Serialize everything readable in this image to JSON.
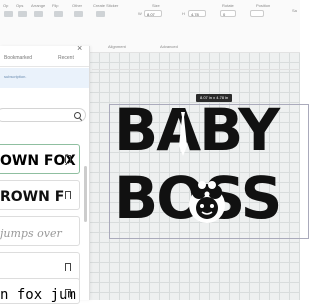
{
  "toolbar": {
    "items": [
      "Op",
      "Ops",
      "Arrange",
      "Flip",
      "Other"
    ],
    "create_sticker": "Create Sticker",
    "w_label": "W",
    "w_value": "8.07",
    "h_label": "H",
    "h_value": "4.78",
    "size_label": "Size",
    "rotate_label": "Rotate",
    "rotate_value": "0",
    "position_label": "Position",
    "alignment_label": "Alignment",
    "advanced_label": "Advanced",
    "save_label": "Sa"
  },
  "panel": {
    "tabs": [
      "Bookmarked",
      "Recent"
    ],
    "notice": "subscription.",
    "font_previews": [
      "OWN FOX J",
      "ROWN F",
      "jumps over",
      "n fox jum"
    ]
  },
  "canvas": {
    "dimension_label": "8.07 in x 4.78 in",
    "line1": "BABY",
    "line2": "BOSS"
  },
  "colors": {
    "canvas_bg": "#eef0f0",
    "text": "#111111",
    "selected_border": "#8fbfa0"
  }
}
